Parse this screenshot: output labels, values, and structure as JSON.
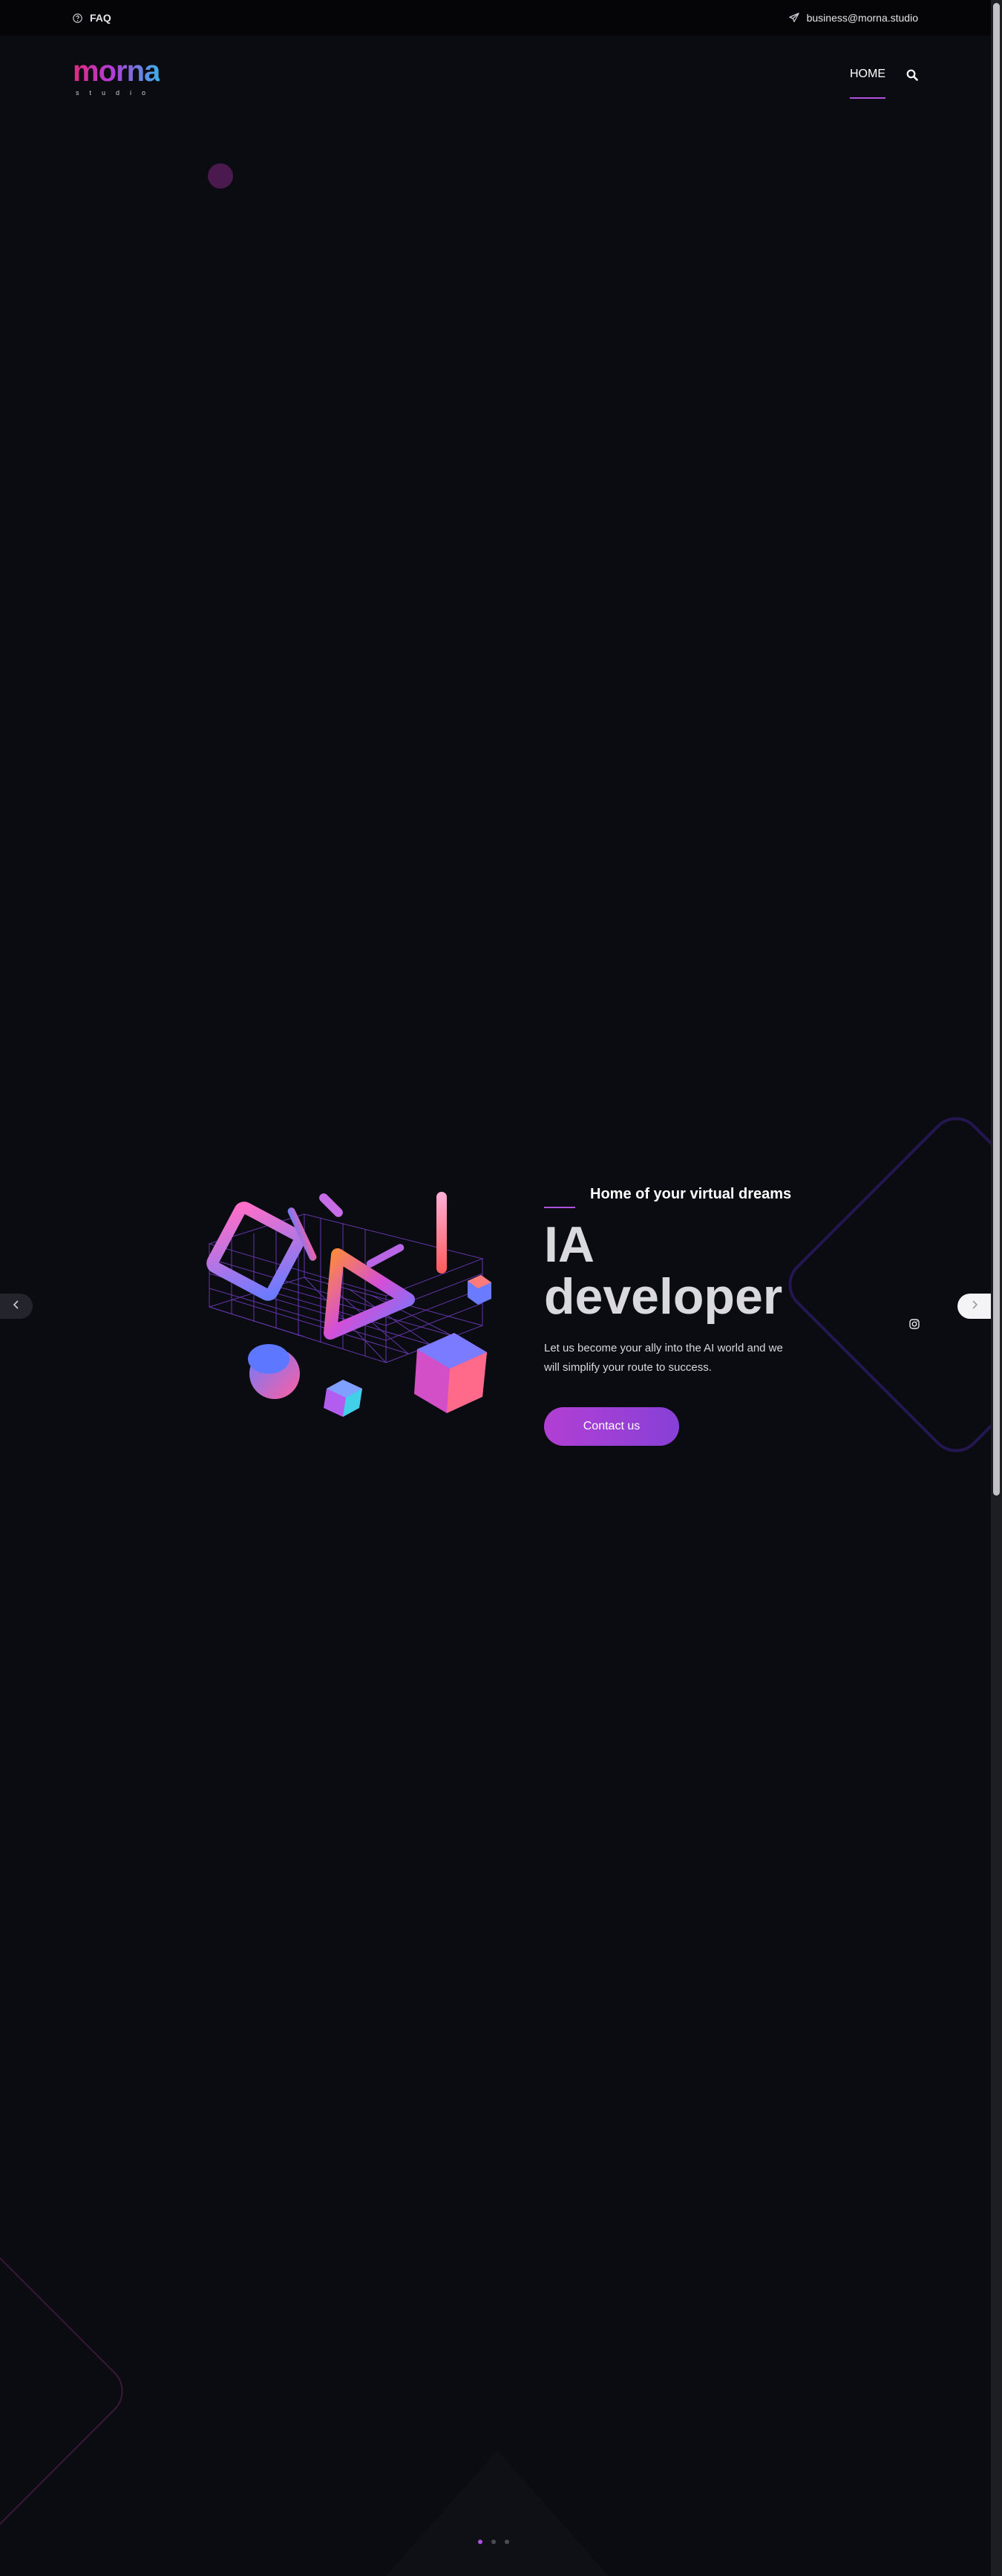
{
  "topbar": {
    "faq_label": "FAQ",
    "email": "business@morna.studio"
  },
  "header": {
    "logo_word": "morna",
    "logo_sub": "studio",
    "nav_home": "HOME"
  },
  "hero": {
    "tagline": "Home of your virtual dreams",
    "headline": "IA developer",
    "description": "Let us become your ally into the AI world and we will simplify your route to success.",
    "cta_label": "Contact us"
  },
  "colors": {
    "background": "#0b0c11",
    "accent": "#b04fe0",
    "topbar": "#050507"
  },
  "icons": {
    "faq": "question-circle-icon",
    "email": "paper-plane-icon",
    "search": "search-icon",
    "social": "instagram-icon",
    "prev": "chevron-left-icon",
    "next": "chevron-right-icon"
  },
  "slider": {
    "total_slides": 3,
    "active_slide": 1
  }
}
